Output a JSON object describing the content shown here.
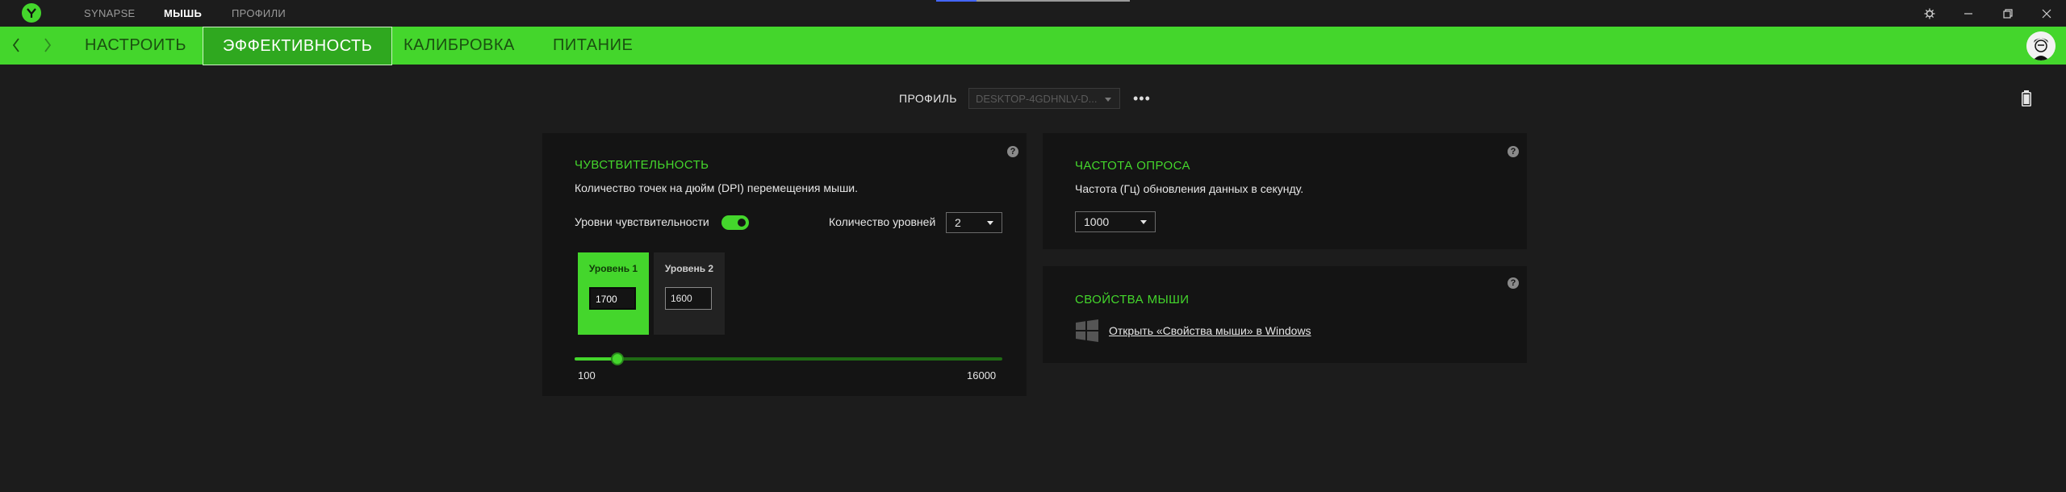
{
  "topnav": {
    "items": [
      "SYNAPSE",
      "МЫШЬ",
      "ПРОФИЛИ"
    ],
    "active": "МЫШЬ"
  },
  "tabs": [
    "НАСТРОИТЬ",
    "ЭФФЕКТИВНОСТЬ",
    "КАЛИБРОВКА",
    "ПИТАНИЕ"
  ],
  "active_tab": "ЭФФЕКТИВНОСТЬ",
  "profile": {
    "label": "ПРОФИЛЬ",
    "value": "DESKTOP-4GDHNLV-D...",
    "more": "•••"
  },
  "sensitivity": {
    "help": "?",
    "title": "ЧУВСТВИТЕЛЬНОСТЬ",
    "description": "Количество точек на дюйм (DPI) перемещения мыши.",
    "levels_toggle_label": "Уровни чувствительности",
    "levels_toggle_on": true,
    "levels_count_label": "Количество уровней",
    "levels_count_value": "2",
    "levels": [
      {
        "label": "Уровень 1",
        "value": "1700",
        "active": true
      },
      {
        "label": "Уровень 2",
        "value": "1600",
        "active": false
      }
    ],
    "slider_min": "100",
    "slider_max": "16000",
    "slider_value": 1700
  },
  "polling": {
    "help": "?",
    "title": "ЧАСТОТА ОПРОСА",
    "description": "Частота (Гц) обновления данных в секунду.",
    "value": "1000"
  },
  "mouse_properties": {
    "help": "?",
    "title": "СВОЙСТВА МЫШИ",
    "link": "Открыть «Свойства мыши» в Windows"
  },
  "colors": {
    "accent": "#44d62c",
    "background": "#1c1c1c",
    "card": "#141414"
  },
  "icons": [
    "razer-logo-icon",
    "settings-icon",
    "minimize-icon",
    "maximize-icon",
    "close-icon",
    "back-icon",
    "forward-icon",
    "battery-icon",
    "windows-icon",
    "help-icon"
  ]
}
